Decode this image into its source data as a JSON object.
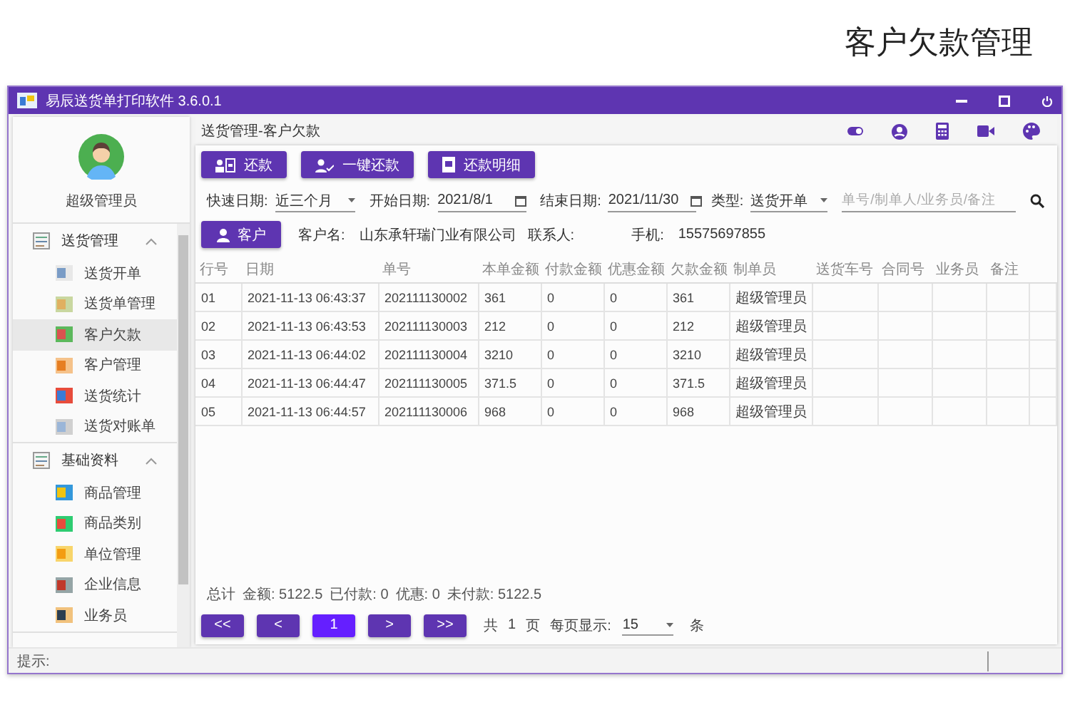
{
  "page_title": "客户欠款管理",
  "window": {
    "title": "易辰送货单打印软件 3.6.0.1"
  },
  "sidebar": {
    "user_name": "超级管理员",
    "groups": [
      {
        "label": "送货管理",
        "expanded": true,
        "items": [
          {
            "label": "送货开单",
            "selected": false
          },
          {
            "label": "送货单管理",
            "selected": false
          },
          {
            "label": "客户欠款",
            "selected": true
          },
          {
            "label": "客户管理",
            "selected": false
          },
          {
            "label": "送货统计",
            "selected": false
          },
          {
            "label": "送货对账单",
            "selected": false
          }
        ]
      },
      {
        "label": "基础资料",
        "expanded": true,
        "items": [
          {
            "label": "商品管理",
            "selected": false
          },
          {
            "label": "商品类别",
            "selected": false
          },
          {
            "label": "单位管理",
            "selected": false
          },
          {
            "label": "企业信息",
            "selected": false
          },
          {
            "label": "业务员",
            "selected": false
          }
        ]
      }
    ]
  },
  "breadcrumb": "送货管理-客户欠款",
  "toolbar_buttons": [
    {
      "label": "还款",
      "kind": "card"
    },
    {
      "label": "一键还款",
      "kind": "person"
    },
    {
      "label": "还款明细",
      "kind": "doc"
    }
  ],
  "filters": {
    "quick_date_label": "快速日期:",
    "quick_date_value": "近三个月",
    "start_label": "开始日期:",
    "start_value": "2021/8/1",
    "end_label": "结束日期:",
    "end_value": "2021/11/30",
    "type_label": "类型:",
    "type_value": "送货开单",
    "search_placeholder": "单号/制单人/业务员/备注"
  },
  "customer": {
    "button": "客户",
    "name_label": "客户名:",
    "name_value": "山东承轩瑞门业有限公司",
    "contact_label": "联系人:",
    "phone_label": "手机:",
    "phone_value": "15575697855"
  },
  "table": {
    "columns": [
      "行号",
      "日期",
      "单号",
      "本单金额",
      "付款金额",
      "优惠金额",
      "欠款金额",
      "制单员",
      "送货车号",
      "合同号",
      "业务员",
      "备注"
    ],
    "rows": [
      [
        "01",
        "2021-11-13 06:43:37",
        "202111130002",
        "361",
        "0",
        "0",
        "361",
        "超级管理员",
        "",
        "",
        "",
        "",
        ""
      ],
      [
        "02",
        "2021-11-13 06:43:53",
        "202111130003",
        "212",
        "0",
        "0",
        "212",
        "超级管理员",
        "",
        "",
        "",
        "",
        ""
      ],
      [
        "03",
        "2021-11-13 06:44:02",
        "202111130004",
        "3210",
        "0",
        "0",
        "3210",
        "超级管理员",
        "",
        "",
        "",
        "",
        ""
      ],
      [
        "04",
        "2021-11-13 06:44:47",
        "202111130005",
        "371.5",
        "0",
        "0",
        "371.5",
        "超级管理员",
        "",
        "",
        "",
        "",
        ""
      ],
      [
        "05",
        "2021-11-13 06:44:57",
        "202111130006",
        "968",
        "0",
        "0",
        "968",
        "超级管理员",
        "",
        "",
        "",
        "",
        ""
      ]
    ]
  },
  "summary": [
    "总计",
    "金额: 5122.5",
    "已付款: 0",
    "优惠: 0",
    "未付款: 5122.5"
  ],
  "pagination": {
    "buttons": [
      {
        "label": "<<",
        "selected": false
      },
      {
        "label": "<",
        "selected": false
      },
      {
        "label": "1",
        "selected": true
      },
      {
        "label": ">",
        "selected": false
      },
      {
        "label": ">>",
        "selected": false
      }
    ],
    "total_prefix": "共",
    "total_pages": "1",
    "total_suffix": "页",
    "per_page_label": "每页显示:",
    "per_page_value": "15",
    "per_page_suffix": "条"
  },
  "status_bar": {
    "hint": "提示:"
  }
}
